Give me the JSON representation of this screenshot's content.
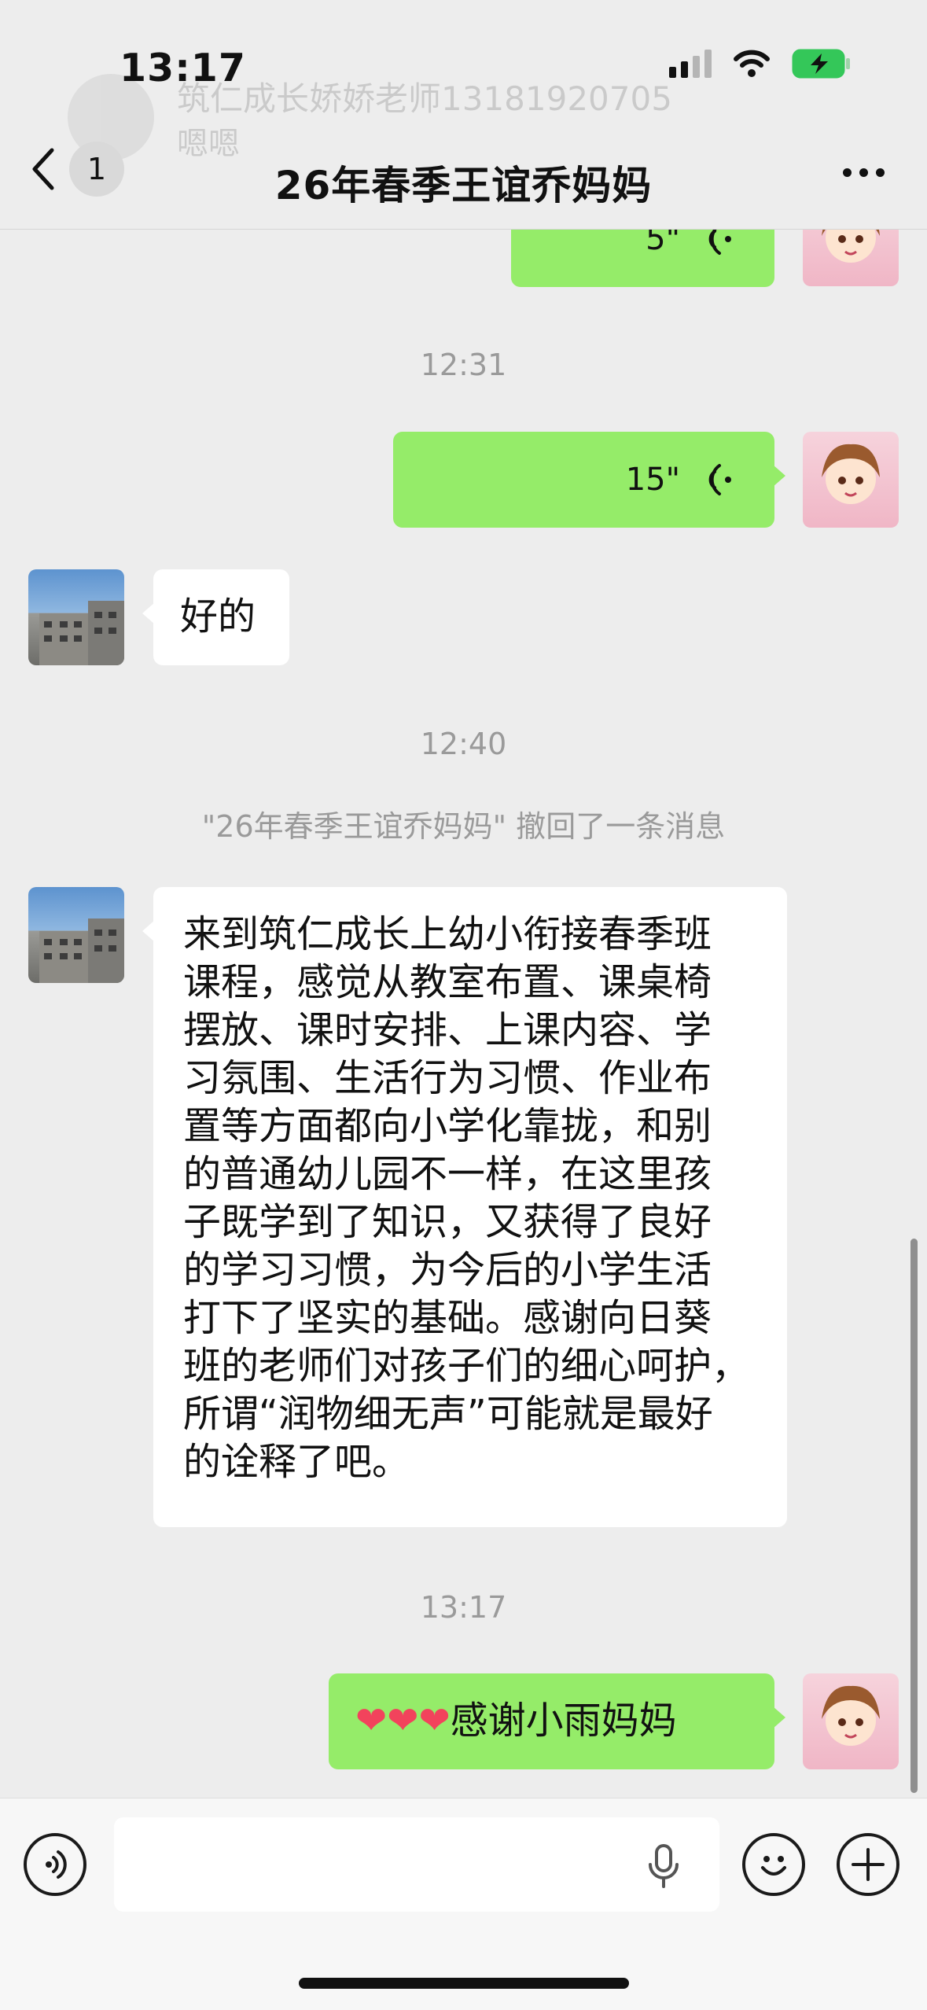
{
  "status_bar": {
    "time": "13:17"
  },
  "notification_banner": {
    "sender": "筑仁成长娇娇老师13181920705",
    "preview": "嗯嗯"
  },
  "header": {
    "unread_count": "1",
    "title": "26年春季王谊乔妈妈"
  },
  "messages": [
    {
      "type": "voice",
      "side": "self",
      "duration": "5\""
    },
    {
      "type": "timestamp",
      "text": "12:31"
    },
    {
      "type": "voice",
      "side": "self",
      "duration": "15\""
    },
    {
      "type": "text",
      "side": "other",
      "text": "好的"
    },
    {
      "type": "timestamp",
      "text": "12:40"
    },
    {
      "type": "system",
      "text": "\"26年春季王谊乔妈妈\" 撤回了一条消息"
    },
    {
      "type": "text",
      "side": "other",
      "lines": [
        "来到筑仁成长上幼小衔接春季班",
        "课程，感觉从教室布置、课桌椅",
        "摆放、课时安排、上课内容、学",
        "习氛围、生活行为习惯、作业布",
        "置等方面都向小学化靠拢，和别",
        "的普通幼儿园不一样，在这里孩",
        "子既学到了知识，又获得了良好",
        "的学习习惯，为今后的小学生活",
        "打下了坚实的基础。感谢向日葵",
        "班的老师们对孩子们的细心呵护，",
        "所谓“润物细无声”可能就是最好",
        "的诠释了吧。"
      ]
    },
    {
      "type": "timestamp",
      "text": "13:17"
    },
    {
      "type": "text",
      "side": "self",
      "hearts": "❤❤❤",
      "text": "感谢小雨妈妈"
    }
  ],
  "input_bar": {
    "placeholder": ""
  },
  "colors": {
    "background": "#ededed",
    "self_bubble": "#95ec69",
    "other_bubble": "#ffffff",
    "timestamp_text": "#9a9a9a",
    "battery_fill": "#34c759"
  },
  "icons": {
    "back": "chevron-left-icon",
    "more": "more-dots-icon",
    "voice_wave": "voice-wave-icon",
    "voice_toggle": "voice-toggle-icon",
    "mic": "microphone-icon",
    "emoji": "emoji-icon",
    "plus": "plus-icon"
  }
}
